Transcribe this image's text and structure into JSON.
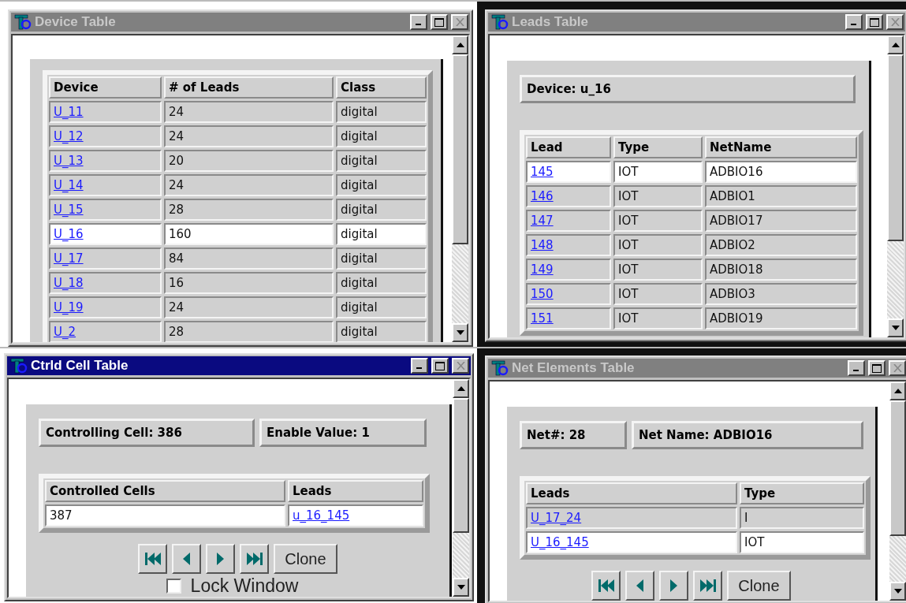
{
  "windows": [
    {
      "kind": "device",
      "title": "Device Table",
      "active": false,
      "table": {
        "columns": [
          {
            "label": "Device",
            "kind": "link"
          },
          {
            "label": "# of Leads",
            "kind": "text"
          },
          {
            "label": "Class",
            "kind": "text"
          }
        ],
        "rows": [
          {
            "cells": [
              "U_11",
              "24",
              "digital"
            ],
            "selected": false
          },
          {
            "cells": [
              "U_12",
              "24",
              "digital"
            ],
            "selected": false
          },
          {
            "cells": [
              "U_13",
              "20",
              "digital"
            ],
            "selected": false
          },
          {
            "cells": [
              "U_14",
              "24",
              "digital"
            ],
            "selected": false
          },
          {
            "cells": [
              "U_15",
              "28",
              "digital"
            ],
            "selected": false
          },
          {
            "cells": [
              "U_16",
              "160",
              "digital"
            ],
            "selected": true
          },
          {
            "cells": [
              "U_17",
              "84",
              "digital"
            ],
            "selected": false
          },
          {
            "cells": [
              "U_18",
              "16",
              "digital"
            ],
            "selected": false
          },
          {
            "cells": [
              "U_19",
              "24",
              "digital"
            ],
            "selected": false
          },
          {
            "cells": [
              "U_2",
              "28",
              "digital"
            ],
            "selected": false
          }
        ]
      }
    },
    {
      "kind": "leads",
      "title": "Leads Table",
      "active": false,
      "fields": [
        "Device: u_16"
      ],
      "table": {
        "columns": [
          {
            "label": "Lead",
            "kind": "link"
          },
          {
            "label": "Type",
            "kind": "text"
          },
          {
            "label": "NetName",
            "kind": "text"
          }
        ],
        "rows": [
          {
            "cells": [
              "145",
              "IOT",
              "ADBIO16"
            ],
            "selected": true
          },
          {
            "cells": [
              "146",
              "IOT",
              "ADBIO1"
            ],
            "selected": false
          },
          {
            "cells": [
              "147",
              "IOT",
              "ADBIO17"
            ],
            "selected": false
          },
          {
            "cells": [
              "148",
              "IOT",
              "ADBIO2"
            ],
            "selected": false
          },
          {
            "cells": [
              "149",
              "IOT",
              "ADBIO18"
            ],
            "selected": false
          },
          {
            "cells": [
              "150",
              "IOT",
              "ADBIO3"
            ],
            "selected": false
          },
          {
            "cells": [
              "151",
              "IOT",
              "ADBIO19"
            ],
            "selected": false
          }
        ]
      }
    },
    {
      "kind": "ctrld",
      "title": "Ctrld Cell Table",
      "active": true,
      "fields": [
        "Controlling Cell: 386",
        "Enable Value: 1"
      ],
      "table": {
        "columns": [
          {
            "label": "Controlled Cells",
            "kind": "text"
          },
          {
            "label": "Leads",
            "kind": "link"
          }
        ],
        "rows": [
          {
            "cells": [
              "387",
              "u_16_145"
            ],
            "selected": true
          }
        ]
      },
      "navigation": {
        "clone_label": "Clone"
      },
      "lock_window": {
        "label": "Lock Window",
        "checked": false
      }
    },
    {
      "kind": "net",
      "title": "Net Elements Table",
      "active": false,
      "fields": [
        "Net#: 28",
        "Net Name: ADBIO16"
      ],
      "table": {
        "columns": [
          {
            "label": "Leads",
            "kind": "link"
          },
          {
            "label": "Type",
            "kind": "text"
          }
        ],
        "rows": [
          {
            "cells": [
              "U_17_24",
              "I"
            ],
            "selected": false
          },
          {
            "cells": [
              "U_16_145",
              "IOT"
            ],
            "selected": true
          }
        ]
      },
      "navigation": {
        "clone_label": "Clone"
      }
    }
  ]
}
